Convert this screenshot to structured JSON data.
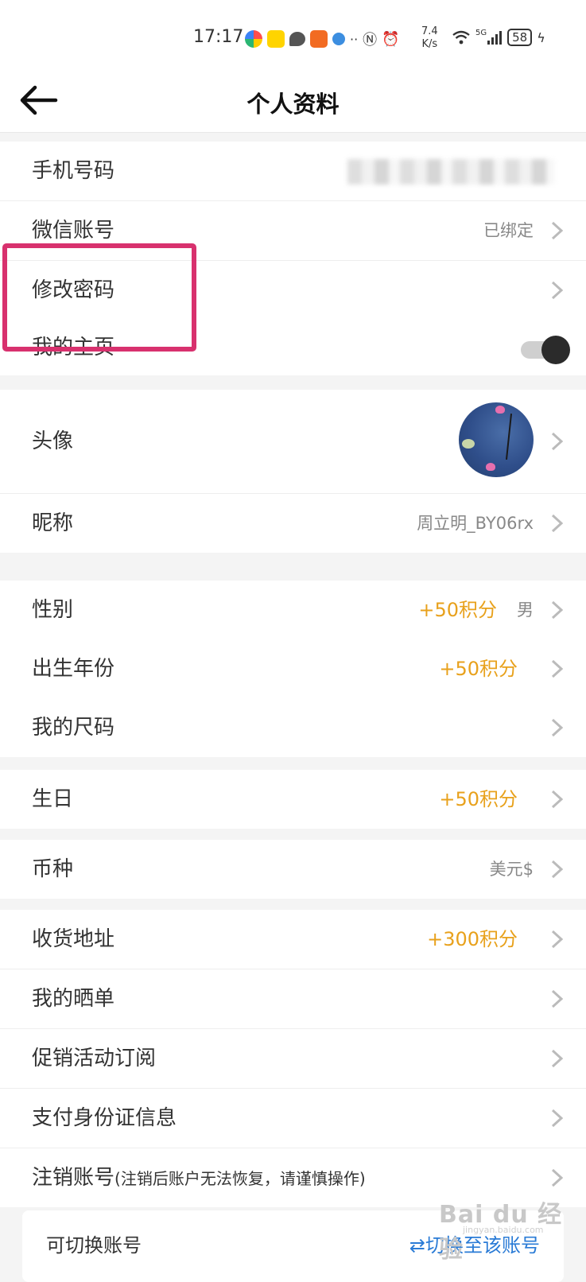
{
  "status_bar": {
    "time": "17:17",
    "net_speed_value": "7.4",
    "net_speed_unit": "K/s",
    "signal": "5G",
    "battery": "58"
  },
  "header": {
    "title": "个人资料"
  },
  "account": {
    "phone_label": "手机号码",
    "wechat_label": "微信账号",
    "wechat_value": "已绑定",
    "password_label": "修改密码",
    "homepage_label": "我的主页",
    "homepage_toggle": true
  },
  "profile": {
    "avatar_label": "头像",
    "nickname_label": "昵称",
    "nickname_value": "周立明_BY06rx"
  },
  "details": {
    "gender_label": "性别",
    "gender_points": "+50积分",
    "gender_value": "男",
    "birth_year_label": "出生年份",
    "birth_year_points": "+50积分",
    "size_label": "我的尺码"
  },
  "birthday": {
    "label": "生日",
    "points": "+50积分"
  },
  "currency": {
    "label": "币种",
    "value": "美元$"
  },
  "more": {
    "address_label": "收货地址",
    "address_points": "+300积分",
    "reviews_label": "我的晒单",
    "promo_label": "促销活动订阅",
    "payment_id_label": "支付身份证信息",
    "cancel_label": "注销账号",
    "cancel_note": "(注销后账户无法恢复，请谨慎操作)"
  },
  "switch_account": {
    "label": "可切换账号",
    "link": "⇄切换至该账号"
  },
  "watermark": {
    "text": "Bai du 经验",
    "sub": "jingyan.baidu.com"
  },
  "colors": {
    "points": "#e8a11c",
    "highlight": "#d8316e",
    "link": "#2a7bd6"
  }
}
